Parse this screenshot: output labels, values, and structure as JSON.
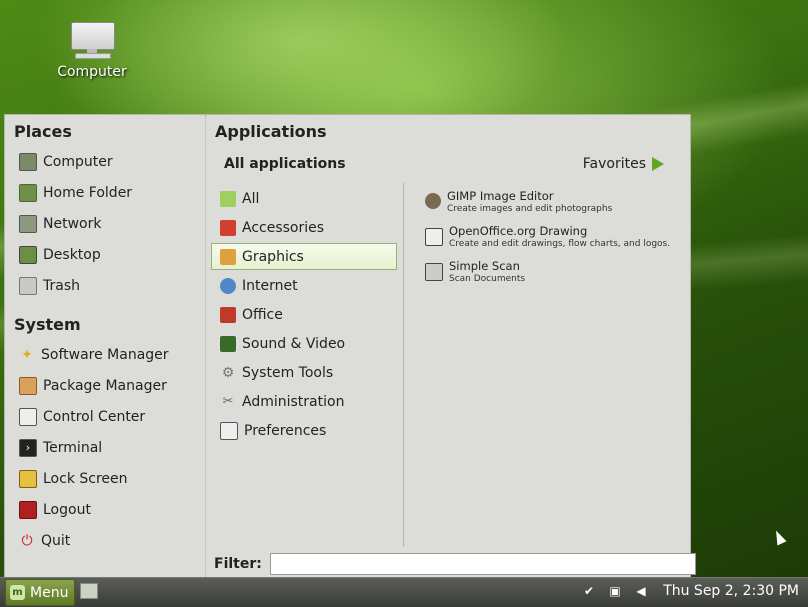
{
  "desktop": {
    "icon_label": "Computer"
  },
  "places": {
    "title": "Places",
    "items": [
      "Computer",
      "Home Folder",
      "Network",
      "Desktop",
      "Trash"
    ]
  },
  "system": {
    "title": "System",
    "items": [
      "Software Manager",
      "Package Manager",
      "Control Center",
      "Terminal",
      "Lock Screen",
      "Logout",
      "Quit"
    ]
  },
  "applications": {
    "title": "Applications",
    "all_label": "All applications",
    "favorites_label": "Favorites",
    "categories": [
      "All",
      "Accessories",
      "Graphics",
      "Internet",
      "Office",
      "Sound & Video",
      "System Tools",
      "Administration",
      "Preferences"
    ],
    "selected_category": "Graphics",
    "apps": [
      {
        "name": "GIMP Image Editor",
        "desc": "Create images and edit photographs"
      },
      {
        "name": "OpenOffice.org Drawing",
        "desc": "Create and edit drawings, flow charts, and logos."
      },
      {
        "name": "Simple Scan",
        "desc": "Scan Documents"
      }
    ]
  },
  "filter": {
    "label": "Filter:",
    "value": ""
  },
  "panel": {
    "menu_label": "Menu",
    "clock": "Thu Sep  2,  2:30 PM"
  },
  "colors": {
    "accent": "#5ea521",
    "panel": "#4a4c48",
    "menu_bg": "#dcdcd9"
  }
}
